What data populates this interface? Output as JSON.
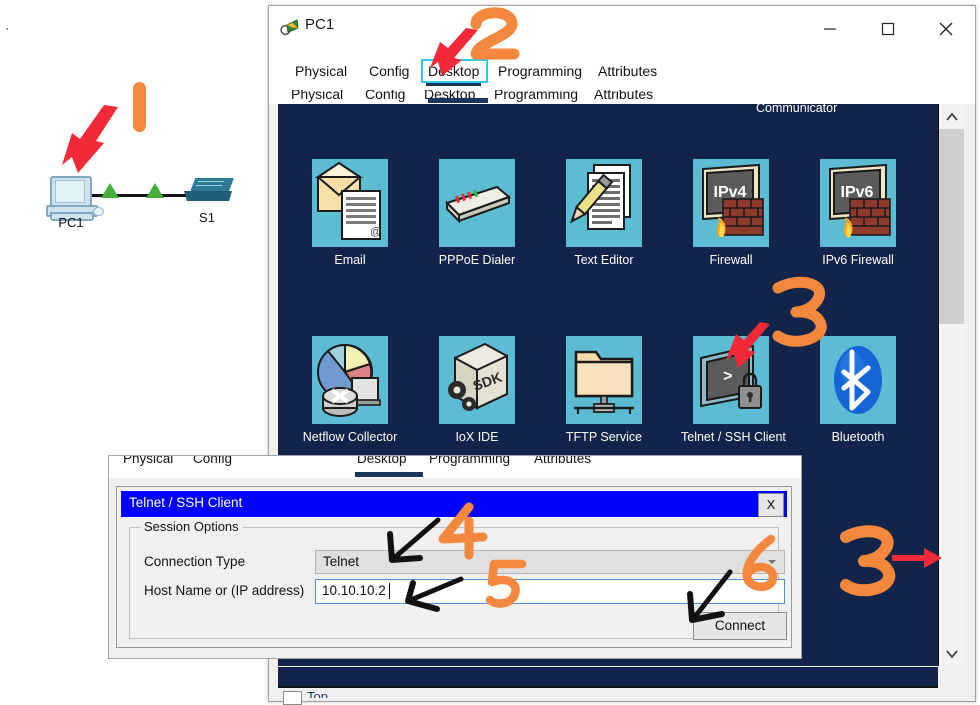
{
  "workspace": {
    "nodes": [
      {
        "id": "pc1",
        "label": "PC1",
        "type": "pc-icon"
      },
      {
        "id": "s1",
        "label": "S1",
        "type": "switch-icon"
      }
    ],
    "link_status_icon": "green-triangle-up"
  },
  "window": {
    "title": "PC1",
    "title_icon": "magnifier-inspect-icon",
    "controls": {
      "minimize": "minimize-icon",
      "maximize": "maximize-icon",
      "close": "close-icon"
    },
    "tabs": [
      {
        "label": "Physical",
        "selected": false
      },
      {
        "label": "Config",
        "selected": false
      },
      {
        "label": "Desktop",
        "selected": true
      },
      {
        "label": "Programming",
        "selected": false
      },
      {
        "label": "Attributes",
        "selected": false
      }
    ]
  },
  "behind_window": {
    "tabs": [
      "Physical",
      "Config",
      "Desktop",
      "Programming",
      "Attributes"
    ]
  },
  "desktop": {
    "cut_top_label": "Communicator",
    "scrollbar": {
      "up_icon": "chevron-up-icon",
      "down_icon": "chevron-down-icon"
    },
    "apps": [
      {
        "label": "Email",
        "icon": "email-envelope-icon"
      },
      {
        "label": "PPPoE Dialer",
        "icon": "modem-icon"
      },
      {
        "label": "Text Editor",
        "icon": "document-pencil-icon"
      },
      {
        "label": "Firewall",
        "icon": "ipv4-firewall-icon",
        "badge": "IPv4"
      },
      {
        "label": "IPv6 Firewall",
        "icon": "ipv6-firewall-icon",
        "badge": "IPv6"
      },
      {
        "label": "Netflow Collector",
        "icon": "pie-chart-icon"
      },
      {
        "label": "IoX IDE",
        "icon": "sdk-box-icon",
        "badge": "SDK"
      },
      {
        "label": "TFTP Service",
        "icon": "folder-network-icon"
      },
      {
        "label": "Telnet / SSH Client",
        "icon": "terminal-lock-icon",
        "badge": ">"
      },
      {
        "label": "Bluetooth",
        "icon": "bluetooth-icon"
      }
    ]
  },
  "telnet_dialog": {
    "tabs": [
      "Physical",
      "Config",
      "Desktop",
      "Programming",
      "Attributes"
    ],
    "title": "Telnet / SSH Client",
    "close_label": "X",
    "group_legend": "Session Options",
    "connection_type_label": "Connection Type",
    "connection_type_value": "Telnet",
    "host_label": "Host Name or (IP address)",
    "host_value": "10.10.10.2",
    "connect_label": "Connect"
  },
  "bottom": {
    "top_checkbox_label": "Top"
  },
  "annotations": {
    "steps": [
      "1",
      "2",
      "3",
      "4",
      "5",
      "6",
      "3"
    ],
    "marker_color": "#f5883c",
    "arrow_red": "#f22a38",
    "arrow_black": "#111111",
    "highlight_box": "#2ecbe8"
  }
}
